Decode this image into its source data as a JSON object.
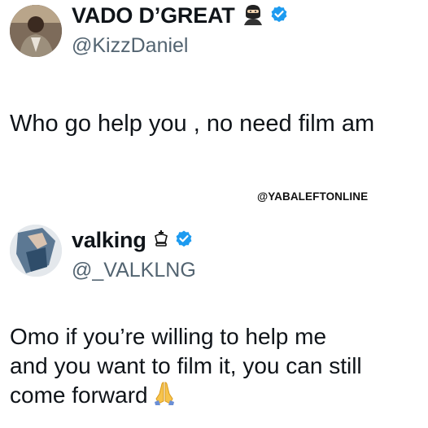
{
  "tweet1": {
    "display_name": "VADO D’GREAT",
    "name_emoji": "ninja-emoji",
    "badge": "verified-badge-icon",
    "handle": "@KizzDaniel",
    "text": "Who go help you , no need film am"
  },
  "watermark": "@YABALEFTONLINE",
  "tweet2": {
    "display_name": "valking",
    "name_emoji": "crown-icon",
    "badge": "verified-badge-icon",
    "handle": "@_VALKLNG",
    "text_lines": [
      "Omo if you’re willing to help me",
      "and you want to film it, you can still",
      "come forward"
    ],
    "trailing_emoji": "folded-hands-emoji"
  },
  "colors": {
    "verified_blue": "#1d9bf0",
    "text": "#0f1419",
    "handle_gray": "#536471"
  }
}
